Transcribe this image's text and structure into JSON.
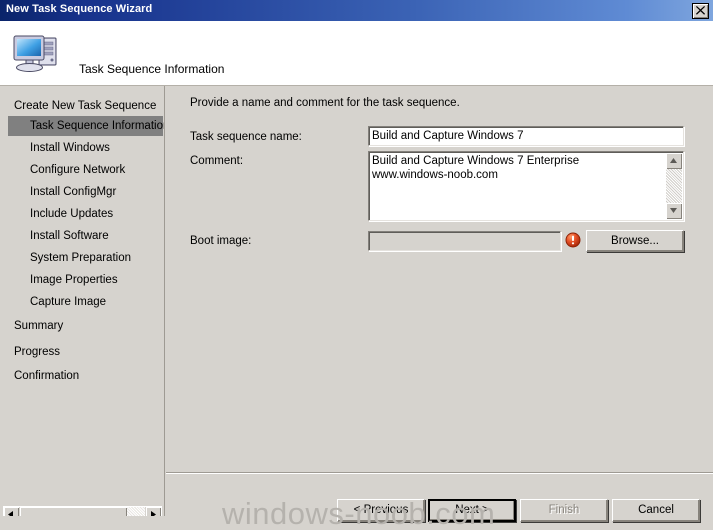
{
  "window": {
    "title": "New Task Sequence Wizard",
    "close_label": "Close"
  },
  "header": {
    "title": "Task Sequence Information",
    "icon": "computer-icon"
  },
  "sidebar": {
    "groups": [
      {
        "label": "Create New Task Sequence",
        "items": [
          {
            "label": "Task Sequence Information",
            "selected": true
          },
          {
            "label": "Install Windows",
            "selected": false
          },
          {
            "label": "Configure Network",
            "selected": false
          },
          {
            "label": "Install ConfigMgr",
            "selected": false
          },
          {
            "label": "Include Updates",
            "selected": false
          },
          {
            "label": "Install Software",
            "selected": false
          },
          {
            "label": "System Preparation",
            "selected": false
          },
          {
            "label": "Image Properties",
            "selected": false
          },
          {
            "label": "Capture Image",
            "selected": false
          }
        ]
      }
    ],
    "standalone": [
      {
        "label": "Summary"
      },
      {
        "label": "Progress"
      },
      {
        "label": "Confirmation"
      }
    ],
    "scrollbar": {
      "left_arrow": "left-arrow-icon",
      "right_arrow": "right-arrow-icon"
    }
  },
  "main": {
    "instruction": "Provide a name and comment for the task sequence.",
    "fields": {
      "task_sequence_name": {
        "label": "Task sequence name:",
        "value": "Build and Capture Windows 7",
        "placeholder": ""
      },
      "comment": {
        "label": "Comment:",
        "lines": [
          "Build and Capture Windows 7 Enterprise",
          "www.windows-noob.com"
        ],
        "scroll_up": "scroll-up-arrow-icon",
        "scroll_down": "scroll-down-arrow-icon"
      },
      "boot_image": {
        "label": "Boot image:",
        "value": "",
        "browse_label": "Browse...",
        "error_icon": "error-exclamation-icon",
        "disabled": true
      }
    }
  },
  "footer": {
    "buttons": [
      {
        "label": "< Previous",
        "enabled": true,
        "default": false
      },
      {
        "label": "Next >",
        "enabled": true,
        "default": true
      },
      {
        "label": "Finish",
        "enabled": false,
        "default": false
      },
      {
        "label": "Cancel",
        "enabled": true,
        "default": false
      }
    ]
  },
  "watermark": {
    "text": "windows-noob.com"
  },
  "colors": {
    "titlebar_dark": "#0a246a",
    "titlebar_light": "#7fa6de",
    "face": "#d6d3ce",
    "selection": "#808080",
    "error_red": "#d94521"
  }
}
